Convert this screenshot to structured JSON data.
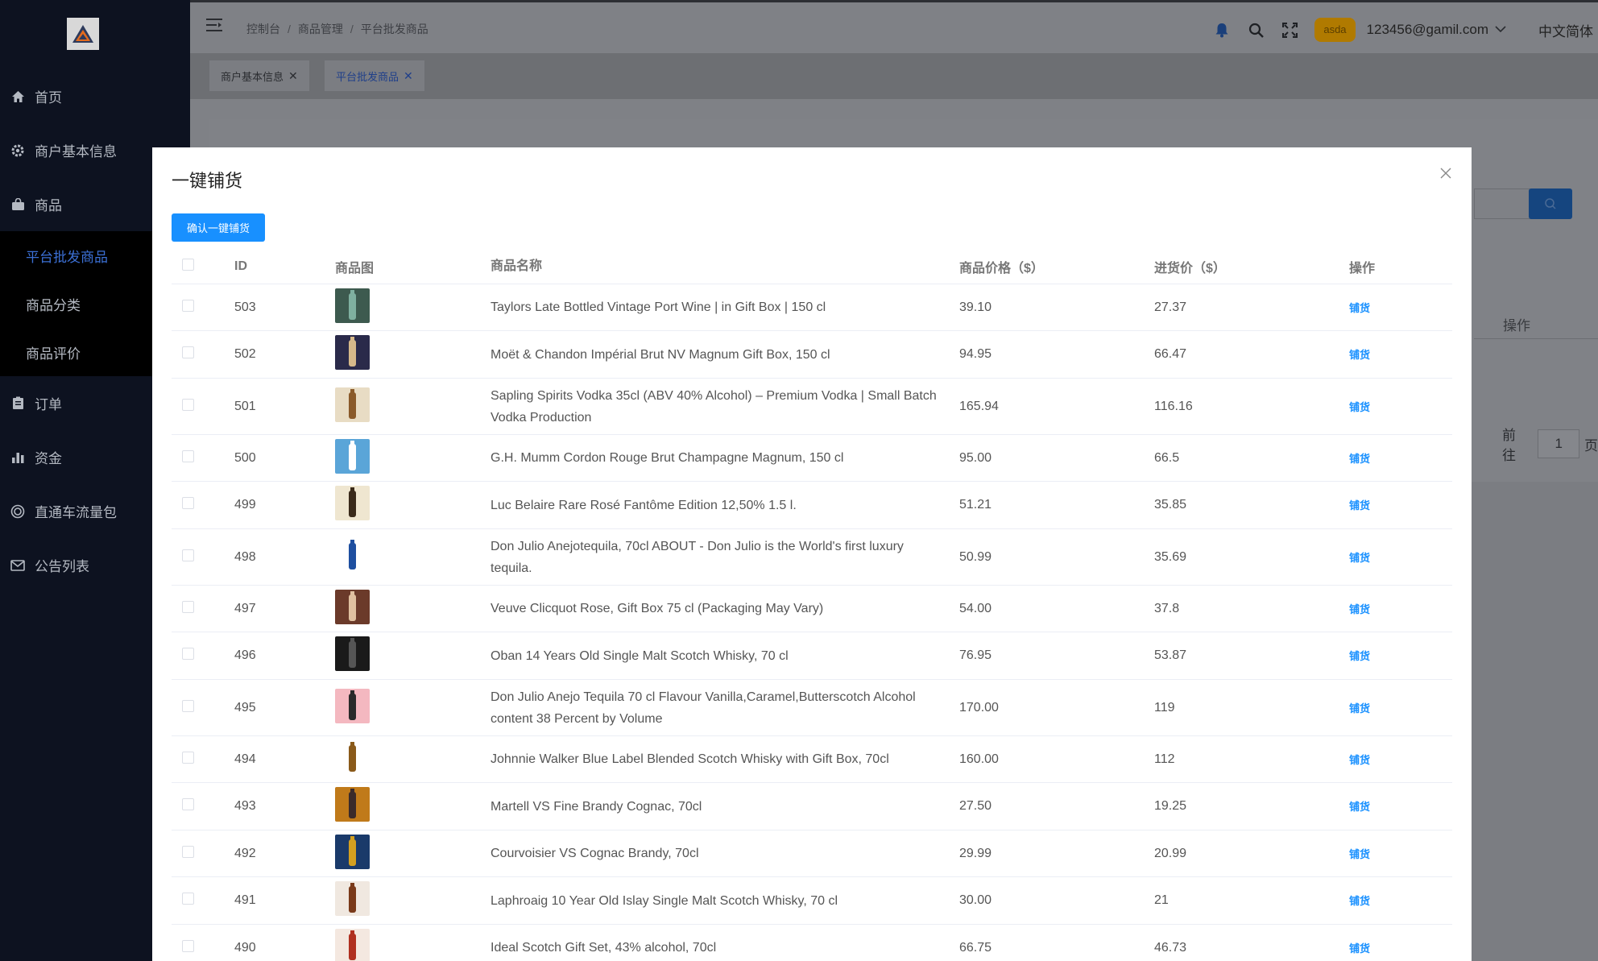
{
  "sidebar": {
    "items": [
      {
        "label": "首页",
        "icon": "home-icon"
      },
      {
        "label": "商户基本信息",
        "icon": "gear-icon"
      },
      {
        "label": "商品",
        "icon": "shopping-bag-icon"
      },
      {
        "label": "订单",
        "icon": "clipboard-icon"
      },
      {
        "label": "资金",
        "icon": "bar-chart-icon"
      },
      {
        "label": "直通车流量包",
        "icon": "target-icon"
      },
      {
        "label": "公告列表",
        "icon": "mail-icon"
      }
    ],
    "submenu": [
      {
        "label": "平台批发商品",
        "active": true
      },
      {
        "label": "商品分类",
        "active": false
      },
      {
        "label": "商品评价",
        "active": false
      }
    ]
  },
  "header": {
    "breadcrumb": [
      "控制台",
      "商品管理",
      "平台批发商品"
    ],
    "badge": "asda",
    "email": "123456@gamil.com",
    "language": "中文简体"
  },
  "tabs": [
    {
      "label": "商户基本信息"
    },
    {
      "label": "平台批发商品"
    }
  ],
  "background": {
    "op_header": "操作",
    "pager_prefix": "前往",
    "pager_value": "1",
    "pager_suffix": "页"
  },
  "modal": {
    "title": "一键铺货",
    "confirm_label": "确认一键铺货",
    "columns": {
      "id": "ID",
      "image": "商品图",
      "name": "商品名称",
      "price": "商品价格（$）",
      "cost": "进货价（$）",
      "op": "操作"
    },
    "op_label": "铺货",
    "rows": [
      {
        "id": "503",
        "name": "Taylors Late Bottled Vintage Port Wine | in Gift Box | 150 cl",
        "price": "39.10",
        "cost": "27.37"
      },
      {
        "id": "502",
        "name": "Moët & Chandon Impérial Brut NV Magnum Gift Box, 150 cl",
        "price": "94.95",
        "cost": "66.47"
      },
      {
        "id": "501",
        "name": "Sapling Spirits Vodka 35cl (ABV 40% Alcohol) – Premium Vodka | Small Batch Vodka Production",
        "price": "165.94",
        "cost": "116.16"
      },
      {
        "id": "500",
        "name": "G.H. Mumm Cordon Rouge Brut Champagne Magnum, 150 cl",
        "price": "95.00",
        "cost": "66.5"
      },
      {
        "id": "499",
        "name": "Luc Belaire Rare Rosé Fantôme Edition 12,50% 1.5 l.",
        "price": "51.21",
        "cost": "35.85"
      },
      {
        "id": "498",
        "name": "Don Julio Anejotequila, 70cl ABOUT - Don Julio is the World's first luxury tequila.",
        "price": "50.99",
        "cost": "35.69"
      },
      {
        "id": "497",
        "name": "Veuve Clicquot Rose, Gift Box 75 cl (Packaging May Vary)",
        "price": "54.00",
        "cost": "37.8"
      },
      {
        "id": "496",
        "name": "Oban 14 Years Old Single Malt Scotch Whisky, 70 cl",
        "price": "76.95",
        "cost": "53.87"
      },
      {
        "id": "495",
        "name": "Don Julio Anejo Tequila 70 cl Flavour Vanilla,Caramel,Butterscotch Alcohol content 38 Percent by Volume",
        "price": "170.00",
        "cost": "119"
      },
      {
        "id": "494",
        "name": "Johnnie Walker Blue Label Blended Scotch Whisky with Gift Box, 70cl",
        "price": "160.00",
        "cost": "112"
      },
      {
        "id": "493",
        "name": "Martell VS Fine Brandy Cognac, 70cl",
        "price": "27.50",
        "cost": "19.25"
      },
      {
        "id": "492",
        "name": "Courvoisier VS Cognac Brandy, 70cl",
        "price": "29.99",
        "cost": "20.99"
      },
      {
        "id": "491",
        "name": "Laphroaig 10 Year Old Islay Single Malt Scotch Whisky, 70 cl",
        "price": "30.00",
        "cost": "21"
      },
      {
        "id": "490",
        "name": "Ideal Scotch Gift Set, 43% alcohol, 70cl",
        "price": "66.75",
        "cost": "46.73"
      }
    ]
  },
  "colors": {
    "primary": "#1890ff",
    "sidebar_bg": "#0d1220",
    "overlay": "#7f8186"
  }
}
